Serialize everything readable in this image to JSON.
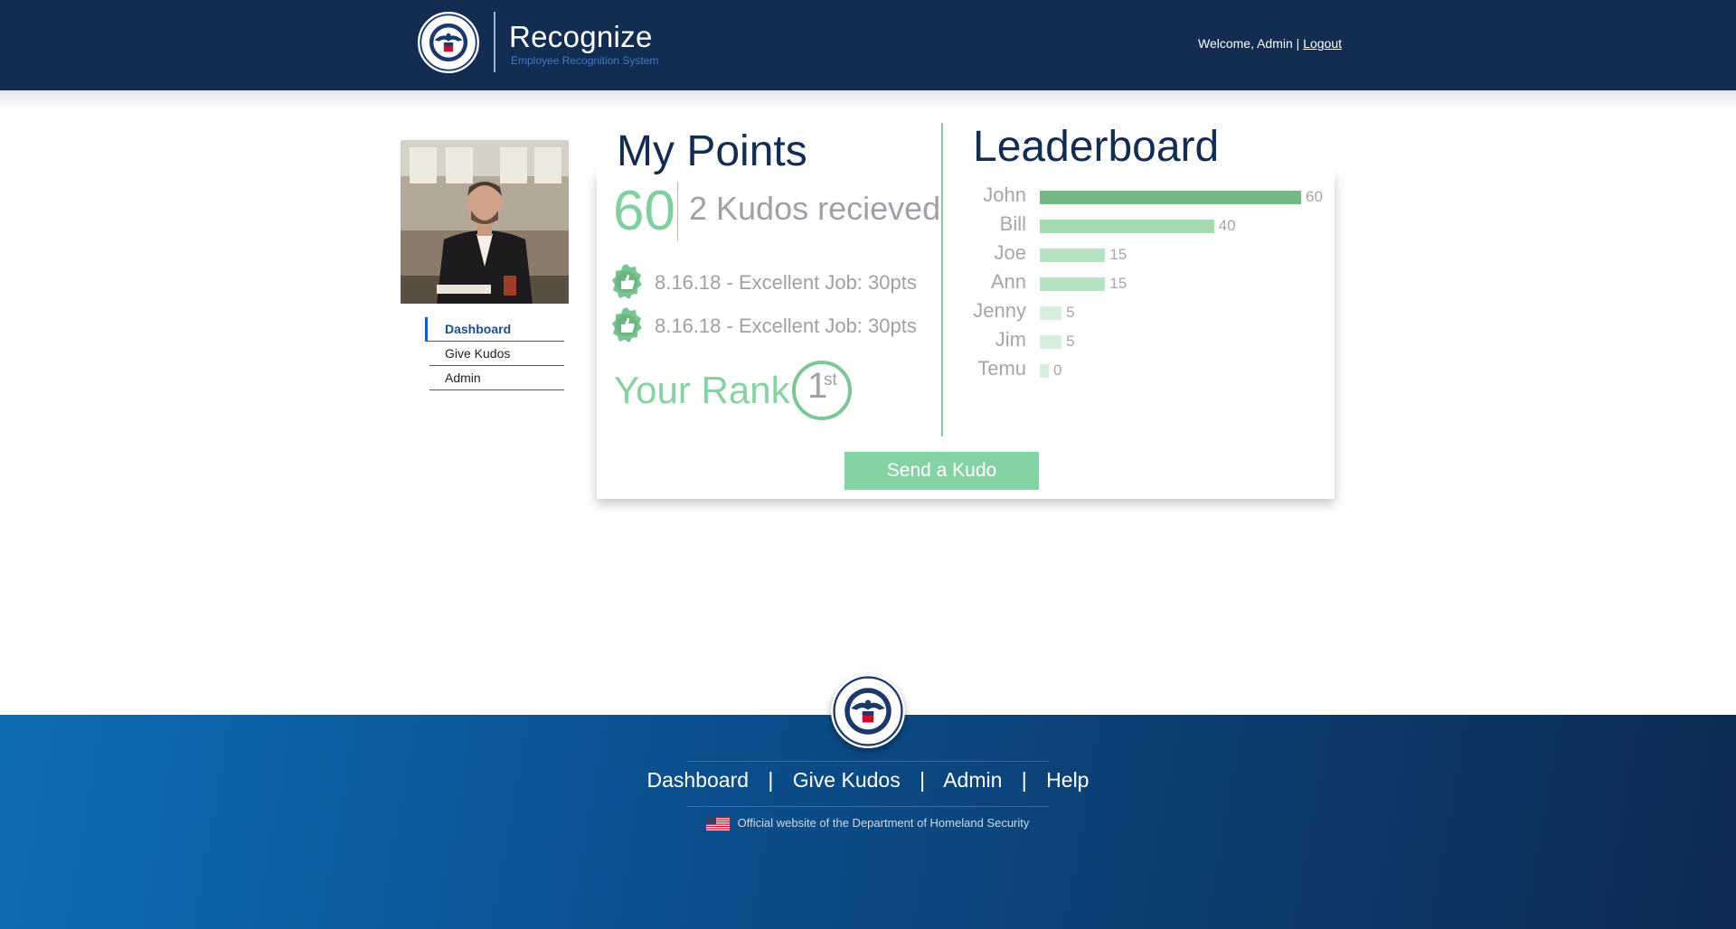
{
  "header": {
    "app_title": "Recognize",
    "app_subtitle": "Employee Recognition System",
    "welcome_text": "Welcome, Admin |",
    "logout_label": "Logout"
  },
  "sidebar": {
    "items": [
      {
        "label": "Dashboard",
        "active": true
      },
      {
        "label": "Give Kudos",
        "active": false
      },
      {
        "label": "Admin",
        "active": false
      }
    ]
  },
  "my_points": {
    "title": "My Points",
    "points": "60",
    "kudos_received": "2 Kudos recieved",
    "kudos": [
      {
        "text": "8.16.18 - Excellent Job: 30pts"
      },
      {
        "text": "8.16.18 - Excellent Job: 30pts"
      }
    ],
    "rank_label": "Your Rank",
    "rank_number": "1",
    "rank_suffix": "st",
    "send_button": "Send a Kudo"
  },
  "leaderboard": {
    "title": "Leaderboard"
  },
  "chart_data": {
    "type": "bar",
    "orientation": "horizontal",
    "title": "Leaderboard",
    "categories": [
      "John",
      "Bill",
      "Joe",
      "Ann",
      "Jenny",
      "Jim",
      "Temu"
    ],
    "values": [
      60,
      40,
      15,
      15,
      5,
      5,
      0
    ],
    "colors": [
      "#72b985",
      "#a3dab1",
      "#b7e3c2",
      "#b7e3c2",
      "#d5efdc",
      "#d5efdc",
      "#d5efdc"
    ],
    "xlim": [
      0,
      60
    ],
    "grid": false,
    "legend": "none"
  },
  "footer": {
    "links": [
      "Dashboard",
      "Give Kudos",
      "Admin",
      "Help"
    ],
    "official_text": "Official website of the Department of Homeland Security"
  },
  "colors": {
    "navy": "#132c52",
    "accent_green": "#85d3a3",
    "footer_blue": "#0f6db6"
  },
  "icons": {
    "seal": "dhs-seal-icon",
    "thumb": "thumbs-up-icon",
    "flag": "us-flag-icon"
  }
}
